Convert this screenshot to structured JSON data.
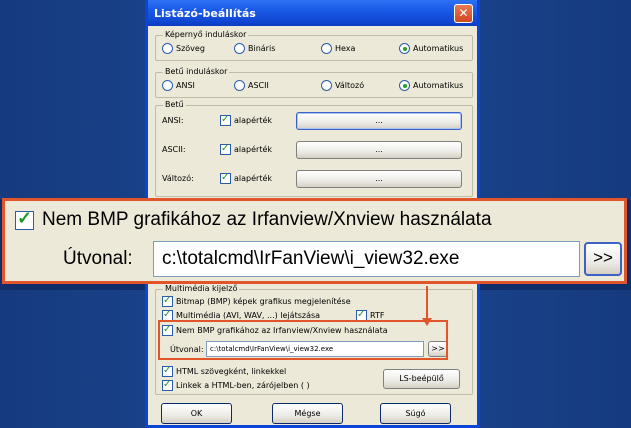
{
  "window": {
    "title": "Listázó-beállítás",
    "close_symbol": "✕"
  },
  "display_start": {
    "title": "Képernyő induláskor",
    "options": [
      "Szöveg",
      "Bináris",
      "Hexa",
      "Automatikus"
    ],
    "selected": "Automatikus"
  },
  "font_start": {
    "title": "Betű induláskor",
    "options": [
      "ANSI",
      "ASCII",
      "Változó",
      "Automatikus"
    ],
    "selected": "Automatikus"
  },
  "fonts": {
    "title": "Betű",
    "rows": [
      {
        "label": "ANSI:",
        "checkbox_label": "alapérték",
        "checked": true,
        "button": "..."
      },
      {
        "label": "ASCII:",
        "checkbox_label": "alapérték",
        "checked": true,
        "button": "..."
      },
      {
        "label": "Változó:",
        "checkbox_label": "alapérték",
        "checked": true,
        "button": "..."
      }
    ]
  },
  "zoom": {
    "checkbox_label": "Nem BMP grafikához az Irfanview/Xnview használata",
    "checked": true,
    "path_label": "Útvonal:",
    "path_value": "c:\\totalcmd\\IrFanView\\i_view32.exe",
    "browse_button": ">>"
  },
  "multimedia": {
    "title": "Multimédia kijelző",
    "bitmap_label": "Bitmap (BMP) képek grafikus megjelenítése",
    "bitmap_checked": true,
    "multimedia_label": "Multimédia (AVI, WAV, ...) lejátszása",
    "multimedia_checked": true,
    "rtf_label": "RTF",
    "rtf_checked": true,
    "irfan_label": "Nem BMP grafikához az Irfanview/Xnview használata",
    "irfan_checked": true,
    "path_label": "Útvonal:",
    "path_value": "c:\\totalcmd\\IrFanView\\i_view32.exe",
    "browse_button": ">>"
  },
  "html_label": "HTML szövegként, linkekkel",
  "html_checked": true,
  "links_label": "Linkek a HTML-ben, zárójelben ( )",
  "links_checked": true,
  "ls_plugin_button": "LS-beépülő",
  "buttons": {
    "ok": "OK",
    "cancel": "Mégse",
    "help": "Súgó"
  },
  "colors": {
    "accent": "#e0552a",
    "title_bar": "#1b5ce8",
    "dialog_bg": "#ece9d8"
  }
}
